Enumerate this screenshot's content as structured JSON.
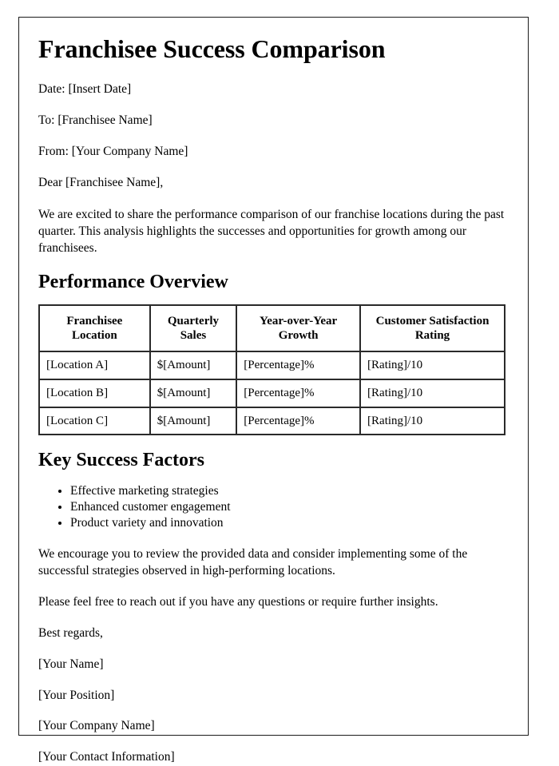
{
  "document": {
    "title": "Franchisee Success Comparison",
    "meta_lines": [
      "Date: [Insert Date]",
      "To: [Franchisee Name]",
      "From: [Your Company Name]"
    ],
    "salutation": "Dear [Franchisee Name],",
    "intro_paragraph": "We are excited to share the performance comparison of our franchise locations during the past quarter. This analysis highlights the successes and opportunities for growth among our franchisees.",
    "sections": {
      "performance": {
        "heading": "Performance Overview",
        "table": {
          "columns": [
            "Franchisee Location",
            "Quarterly Sales",
            "Year-over-Year Growth",
            "Customer Satisfaction Rating"
          ],
          "rows": [
            [
              "[Location A]",
              "$[Amount]",
              "[Percentage]%",
              "[Rating]/10"
            ],
            [
              "[Location B]",
              "$[Amount]",
              "[Percentage]%",
              "[Rating]/10"
            ],
            [
              "[Location C]",
              "$[Amount]",
              "[Percentage]%",
              "[Rating]/10"
            ]
          ]
        }
      },
      "success_factors": {
        "heading": "Key Success Factors",
        "items": [
          "Effective marketing strategies",
          "Enhanced customer engagement",
          "Product variety and innovation"
        ]
      }
    },
    "closing_paragraphs": [
      "We encourage you to review the provided data and consider implementing some of the successful strategies observed in high-performing locations.",
      "Please feel free to reach out if you have any questions or require further insights."
    ],
    "signoff": "Best regards,",
    "signature_lines": [
      "[Your Name]",
      "[Your Position]",
      "[Your Company Name]",
      "[Your Contact Information]"
    ]
  }
}
